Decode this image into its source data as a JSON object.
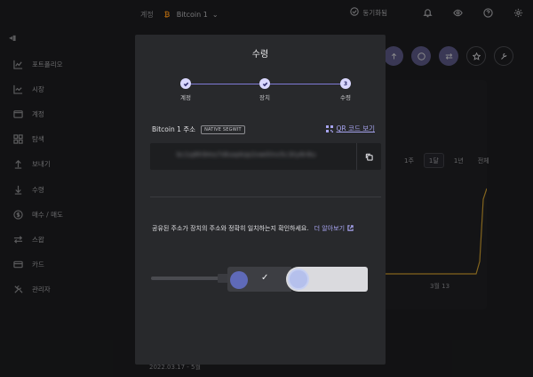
{
  "window": {
    "controls": [
      "close",
      "minimize",
      "maximize"
    ]
  },
  "sidebar": {
    "collapse_icon": "sidebar-collapse-icon",
    "items": [
      {
        "label": "포트폴리오",
        "icon": "chart-line-icon"
      },
      {
        "label": "시장",
        "icon": "trend-icon"
      },
      {
        "label": "계정",
        "icon": "wallet-icon"
      },
      {
        "label": "탐색",
        "icon": "grid-icon"
      },
      {
        "label": "보내기",
        "icon": "arrow-up-icon"
      },
      {
        "label": "수령",
        "icon": "arrow-down-icon"
      },
      {
        "label": "매수 / 매도",
        "icon": "dollar-icon"
      },
      {
        "label": "스왑",
        "icon": "swap-icon"
      },
      {
        "label": "카드",
        "icon": "card-icon"
      },
      {
        "label": "관리자",
        "icon": "tools-icon"
      }
    ]
  },
  "topbar": {
    "breadcrumb_root": "계정",
    "account_name": "Bitcoin 1",
    "sync_label": "동기화됨"
  },
  "background": {
    "range_buttons": [
      "1주",
      "1달",
      "1년",
      "전체"
    ],
    "range_active": "1달",
    "chart_date": "3월 13",
    "bottom_date": "2022.03.17 - 5월"
  },
  "modal": {
    "title": "수령",
    "steps": [
      {
        "label": "계정",
        "state": "done"
      },
      {
        "label": "장치",
        "state": "done"
      },
      {
        "label": "수령",
        "state": "current",
        "number": "3"
      }
    ],
    "address_label": "Bitcoin 1 주소",
    "address_type_badge": "NATIVE SEGWIT",
    "qr_link": "QR 코드 보기",
    "address_value": "bc1q8h9ms7dkaq4zp2xw0lnv5c3ty6r8u",
    "verify_message": "공유된 주소가 장치의 주소와 정확히 일치하는지 확인하세요.",
    "learn_more": "더 알아보기"
  },
  "colors": {
    "accent": "#a7a4f0",
    "step_line": "#7f7bd6",
    "bitcoin": "#f7931a",
    "chart_line": "#c99a2e"
  }
}
